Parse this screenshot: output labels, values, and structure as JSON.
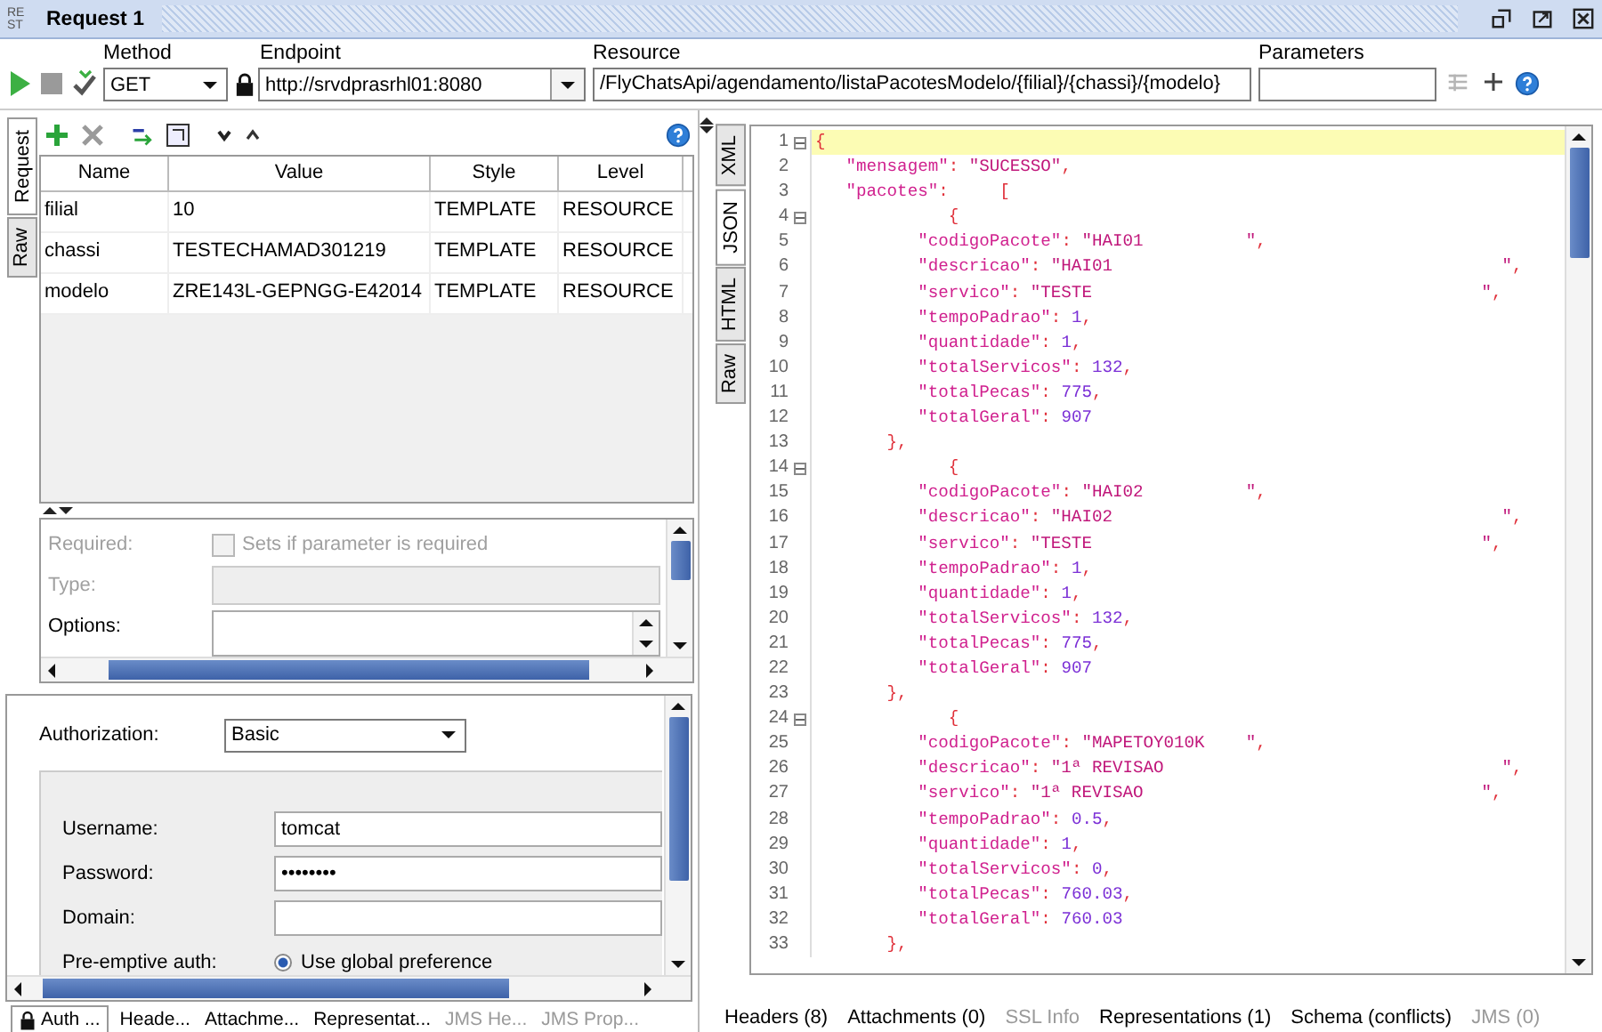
{
  "window": {
    "logo": [
      "RE",
      "ST"
    ],
    "title": "Request 1"
  },
  "toolbar": {
    "method": {
      "label": "Method",
      "value": "GET"
    },
    "endpoint": {
      "label": "Endpoint",
      "value": "http://srvdprasrhl01:8080"
    },
    "resource": {
      "label": "Resource",
      "value": "/FlyChatsApi/agendamento/listaPacotesModelo/{filial}/{chassi}/{modelo}"
    },
    "parameters": {
      "label": "Parameters"
    }
  },
  "request_tabs": [
    {
      "label": "Request",
      "selected": true
    },
    {
      "label": "Raw",
      "selected": false
    }
  ],
  "params_table": {
    "columns": [
      "Name",
      "Value",
      "Style",
      "Level"
    ],
    "rows": [
      [
        "filial",
        "10",
        "TEMPLATE",
        "RESOURCE"
      ],
      [
        "chassi",
        "TESTECHAMAD301219",
        "TEMPLATE",
        "RESOURCE"
      ],
      [
        "modelo",
        "ZRE143L-GEPNGG-E42014",
        "TEMPLATE",
        "RESOURCE"
      ]
    ]
  },
  "param_details": {
    "required": {
      "label": "Required:",
      "checkbox_label": "Sets if parameter is required",
      "checked": false,
      "disabled": true
    },
    "type": {
      "label": "Type:",
      "disabled": true
    },
    "options": {
      "label": "Options:",
      "disabled": false
    }
  },
  "auth": {
    "label": "Authorization:",
    "value": "Basic",
    "fields": [
      {
        "label": "Username:",
        "value": "tomcat"
      },
      {
        "label": "Password:",
        "value": "••••••••"
      },
      {
        "label": "Domain:"
      }
    ],
    "preemptive": {
      "label": "Pre-emptive auth:",
      "options": [
        {
          "label": "Use global preference",
          "selected": true
        }
      ]
    }
  },
  "request_bottom_tabs": [
    {
      "label": "Auth ...",
      "selected": true,
      "disabled": false,
      "lock": true
    },
    {
      "label": "Heade...",
      "selected": false,
      "disabled": false,
      "lock": false
    },
    {
      "label": "Attachme...",
      "selected": false,
      "disabled": false,
      "lock": false
    },
    {
      "label": "Representat...",
      "selected": false,
      "disabled": false,
      "lock": false
    },
    {
      "label": "JMS He...",
      "selected": false,
      "disabled": true,
      "lock": false
    },
    {
      "label": "JMS Prop...",
      "selected": false,
      "disabled": true,
      "lock": false
    }
  ],
  "response_view_tabs": [
    {
      "label": "XML",
      "selected": false
    },
    {
      "label": "JSON",
      "selected": true
    },
    {
      "label": "HTML",
      "selected": false
    },
    {
      "label": "Raw",
      "selected": false
    }
  ],
  "response_lines": [
    {
      "n": "1",
      "fold": true,
      "current": true,
      "code": [
        {
          "kind": "punct",
          "text": "{"
        }
      ]
    },
    {
      "n": "2",
      "fold": false,
      "current": false,
      "code": [
        {
          "kind": "key",
          "text": "   \"mensagem\""
        },
        {
          "kind": "punct",
          "text": ": "
        },
        {
          "kind": "string",
          "text": "\"SUCESSO\""
        },
        {
          "kind": "punct",
          "text": ","
        }
      ]
    },
    {
      "n": "3",
      "fold": false,
      "current": false,
      "code": [
        {
          "kind": "key",
          "text": "   \"pacotes\""
        },
        {
          "kind": "punct",
          "text": ":     ["
        }
      ]
    },
    {
      "n": "4",
      "fold": true,
      "current": false,
      "code": [
        {
          "kind": "punct",
          "text": "             {"
        }
      ]
    },
    {
      "n": "5",
      "fold": false,
      "current": false,
      "code": [
        {
          "kind": "key",
          "text": "          \"codigoPacote\""
        },
        {
          "kind": "punct",
          "text": ": "
        },
        {
          "kind": "string",
          "text": "\"HAI01          \""
        },
        {
          "kind": "punct",
          "text": ","
        }
      ]
    },
    {
      "n": "6",
      "fold": false,
      "current": false,
      "code": [
        {
          "kind": "key",
          "text": "          \"descricao\""
        },
        {
          "kind": "punct",
          "text": ": "
        },
        {
          "kind": "string",
          "text": "\"HAI01                                      \""
        },
        {
          "kind": "punct",
          "text": ","
        }
      ]
    },
    {
      "n": "7",
      "fold": false,
      "current": false,
      "code": [
        {
          "kind": "key",
          "text": "          \"servico\""
        },
        {
          "kind": "punct",
          "text": ": "
        },
        {
          "kind": "string",
          "text": "\"TESTE                                      \""
        },
        {
          "kind": "punct",
          "text": ","
        }
      ]
    },
    {
      "n": "8",
      "fold": false,
      "current": false,
      "code": [
        {
          "kind": "key",
          "text": "          \"tempoPadrao\""
        },
        {
          "kind": "punct",
          "text": ": "
        },
        {
          "kind": "number",
          "text": "1"
        },
        {
          "kind": "punct",
          "text": ","
        }
      ]
    },
    {
      "n": "9",
      "fold": false,
      "current": false,
      "code": [
        {
          "kind": "key",
          "text": "          \"quantidade\""
        },
        {
          "kind": "punct",
          "text": ": "
        },
        {
          "kind": "number",
          "text": "1"
        },
        {
          "kind": "punct",
          "text": ","
        }
      ]
    },
    {
      "n": "10",
      "fold": false,
      "current": false,
      "code": [
        {
          "kind": "key",
          "text": "          \"totalServicos\""
        },
        {
          "kind": "punct",
          "text": ": "
        },
        {
          "kind": "number",
          "text": "132"
        },
        {
          "kind": "punct",
          "text": ","
        }
      ]
    },
    {
      "n": "11",
      "fold": false,
      "current": false,
      "code": [
        {
          "kind": "key",
          "text": "          \"totalPecas\""
        },
        {
          "kind": "punct",
          "text": ": "
        },
        {
          "kind": "number",
          "text": "775"
        },
        {
          "kind": "punct",
          "text": ","
        }
      ]
    },
    {
      "n": "12",
      "fold": false,
      "current": false,
      "code": [
        {
          "kind": "key",
          "text": "          \"totalGeral\""
        },
        {
          "kind": "punct",
          "text": ": "
        },
        {
          "kind": "number",
          "text": "907"
        }
      ]
    },
    {
      "n": "13",
      "fold": false,
      "current": false,
      "code": [
        {
          "kind": "punct",
          "text": "       },"
        }
      ]
    },
    {
      "n": "14",
      "fold": true,
      "current": false,
      "code": [
        {
          "kind": "punct",
          "text": "             {"
        }
      ]
    },
    {
      "n": "15",
      "fold": false,
      "current": false,
      "code": [
        {
          "kind": "key",
          "text": "          \"codigoPacote\""
        },
        {
          "kind": "punct",
          "text": ": "
        },
        {
          "kind": "string",
          "text": "\"HAI02          \""
        },
        {
          "kind": "punct",
          "text": ","
        }
      ]
    },
    {
      "n": "16",
      "fold": false,
      "current": false,
      "code": [
        {
          "kind": "key",
          "text": "          \"descricao\""
        },
        {
          "kind": "punct",
          "text": ": "
        },
        {
          "kind": "string",
          "text": "\"HAI02                                      \""
        },
        {
          "kind": "punct",
          "text": ","
        }
      ]
    },
    {
      "n": "17",
      "fold": false,
      "current": false,
      "code": [
        {
          "kind": "key",
          "text": "          \"servico\""
        },
        {
          "kind": "punct",
          "text": ": "
        },
        {
          "kind": "string",
          "text": "\"TESTE                                      \""
        },
        {
          "kind": "punct",
          "text": ","
        }
      ]
    },
    {
      "n": "18",
      "fold": false,
      "current": false,
      "code": [
        {
          "kind": "key",
          "text": "          \"tempoPadrao\""
        },
        {
          "kind": "punct",
          "text": ": "
        },
        {
          "kind": "number",
          "text": "1"
        },
        {
          "kind": "punct",
          "text": ","
        }
      ]
    },
    {
      "n": "19",
      "fold": false,
      "current": false,
      "code": [
        {
          "kind": "key",
          "text": "          \"quantidade\""
        },
        {
          "kind": "punct",
          "text": ": "
        },
        {
          "kind": "number",
          "text": "1"
        },
        {
          "kind": "punct",
          "text": ","
        }
      ]
    },
    {
      "n": "20",
      "fold": false,
      "current": false,
      "code": [
        {
          "kind": "key",
          "text": "          \"totalServicos\""
        },
        {
          "kind": "punct",
          "text": ": "
        },
        {
          "kind": "number",
          "text": "132"
        },
        {
          "kind": "punct",
          "text": ","
        }
      ]
    },
    {
      "n": "21",
      "fold": false,
      "current": false,
      "code": [
        {
          "kind": "key",
          "text": "          \"totalPecas\""
        },
        {
          "kind": "punct",
          "text": ": "
        },
        {
          "kind": "number",
          "text": "775"
        },
        {
          "kind": "punct",
          "text": ","
        }
      ]
    },
    {
      "n": "22",
      "fold": false,
      "current": false,
      "code": [
        {
          "kind": "key",
          "text": "          \"totalGeral\""
        },
        {
          "kind": "punct",
          "text": ": "
        },
        {
          "kind": "number",
          "text": "907"
        }
      ]
    },
    {
      "n": "23",
      "fold": false,
      "current": false,
      "code": [
        {
          "kind": "punct",
          "text": "       },"
        }
      ]
    },
    {
      "n": "24",
      "fold": true,
      "current": false,
      "code": [
        {
          "kind": "punct",
          "text": "             {"
        }
      ]
    },
    {
      "n": "25",
      "fold": false,
      "current": false,
      "code": [
        {
          "kind": "key",
          "text": "          \"codigoPacote\""
        },
        {
          "kind": "punct",
          "text": ": "
        },
        {
          "kind": "string",
          "text": "\"MAPETOY010K    \""
        },
        {
          "kind": "punct",
          "text": ","
        }
      ]
    },
    {
      "n": "26",
      "fold": false,
      "current": false,
      "code": [
        {
          "kind": "key",
          "text": "          \"descricao\""
        },
        {
          "kind": "punct",
          "text": ": "
        },
        {
          "kind": "string",
          "text": "\"1ª REVISAO                                 \""
        },
        {
          "kind": "punct",
          "text": ","
        }
      ]
    },
    {
      "n": "27",
      "fold": false,
      "current": false,
      "code": [
        {
          "kind": "key",
          "text": "          \"servico\""
        },
        {
          "kind": "punct",
          "text": ": "
        },
        {
          "kind": "string",
          "text": "\"1ª REVISAO                                 \""
        },
        {
          "kind": "punct",
          "text": ","
        }
      ]
    },
    {
      "n": "28",
      "fold": false,
      "current": false,
      "code": [
        {
          "kind": "key",
          "text": "          \"tempoPadrao\""
        },
        {
          "kind": "punct",
          "text": ": "
        },
        {
          "kind": "number",
          "text": "0.5"
        },
        {
          "kind": "punct",
          "text": ","
        }
      ]
    },
    {
      "n": "29",
      "fold": false,
      "current": false,
      "code": [
        {
          "kind": "key",
          "text": "          \"quantidade\""
        },
        {
          "kind": "punct",
          "text": ": "
        },
        {
          "kind": "number",
          "text": "1"
        },
        {
          "kind": "punct",
          "text": ","
        }
      ]
    },
    {
      "n": "30",
      "fold": false,
      "current": false,
      "code": [
        {
          "kind": "key",
          "text": "          \"totalServicos\""
        },
        {
          "kind": "punct",
          "text": ": "
        },
        {
          "kind": "number",
          "text": "0"
        },
        {
          "kind": "punct",
          "text": ","
        }
      ]
    },
    {
      "n": "31",
      "fold": false,
      "current": false,
      "code": [
        {
          "kind": "key",
          "text": "          \"totalPecas\""
        },
        {
          "kind": "punct",
          "text": ": "
        },
        {
          "kind": "number",
          "text": "760.03"
        },
        {
          "kind": "punct",
          "text": ","
        }
      ]
    },
    {
      "n": "32",
      "fold": false,
      "current": false,
      "code": [
        {
          "kind": "key",
          "text": "          \"totalGeral\""
        },
        {
          "kind": "punct",
          "text": ": "
        },
        {
          "kind": "number",
          "text": "760.03"
        }
      ]
    },
    {
      "n": "33",
      "fold": false,
      "current": false,
      "code": [
        {
          "kind": "punct",
          "text": "       },"
        }
      ]
    }
  ],
  "response_bottom_tabs": [
    {
      "label": "Headers (8)",
      "disabled": false
    },
    {
      "label": "Attachments (0)",
      "disabled": false
    },
    {
      "label": "SSL Info",
      "disabled": true
    },
    {
      "label": "Representations (1)",
      "disabled": false
    },
    {
      "label": "Schema (conflicts)",
      "disabled": false
    },
    {
      "label": "JMS (0)",
      "disabled": true
    }
  ]
}
